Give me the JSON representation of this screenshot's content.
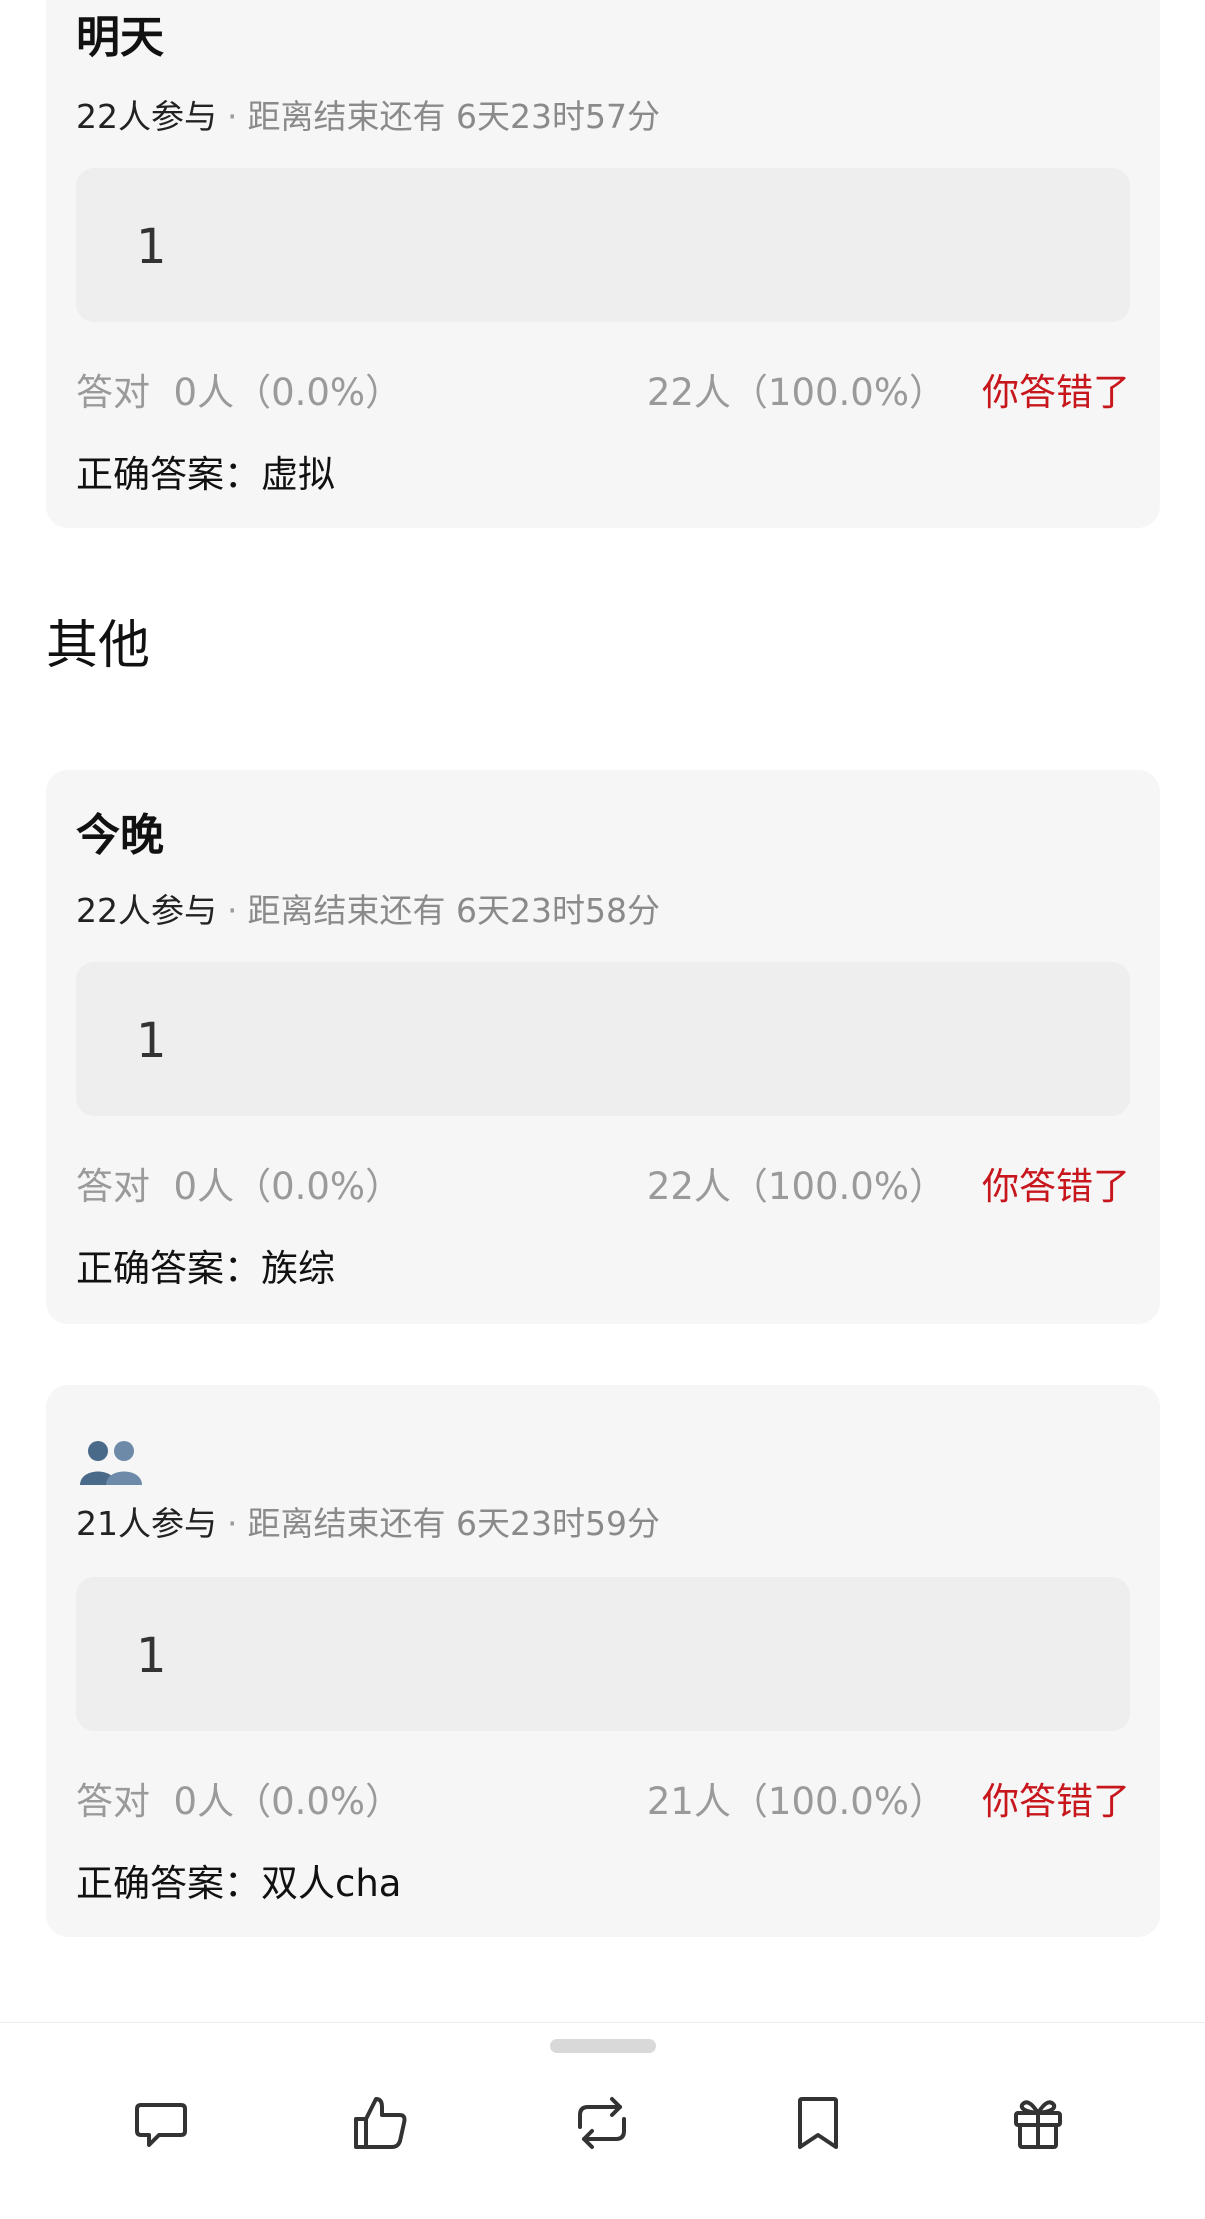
{
  "cards": [
    {
      "title": "明天",
      "participants": "22人参与",
      "separator": "·",
      "deadline": "距离结束还有 6天23时57分",
      "answer": "1",
      "correct_stat_label": "答对",
      "correct_stat": "0人（0.0%）",
      "wrong_stat": "22人（100.0%）",
      "result_label": "你答错了",
      "correct_answer_label": "正确答案：",
      "correct_answer": "虚拟"
    },
    {
      "title": "今晚",
      "participants": "22人参与",
      "separator": "·",
      "deadline": "距离结束还有 6天23时58分",
      "answer": "1",
      "correct_stat_label": "答对",
      "correct_stat": "0人（0.0%）",
      "wrong_stat": "22人（100.0%）",
      "result_label": "你答错了",
      "correct_answer_label": "正确答案：",
      "correct_answer": "族综"
    },
    {
      "title_icon": "two-people-silhouette-emoji",
      "participants": "21人参与",
      "separator": "·",
      "deadline": "距离结束还有 6天23时59分",
      "answer": "1",
      "correct_stat_label": "答对",
      "correct_stat": "0人（0.0%）",
      "wrong_stat": "21人（100.0%）",
      "result_label": "你答错了",
      "correct_answer_label": "正确答案：",
      "correct_answer": "双人cha"
    }
  ],
  "section_heading": "其他",
  "toolbar": {
    "items": [
      "comment-icon",
      "like-icon",
      "repost-icon",
      "bookmark-icon",
      "gift-icon"
    ]
  },
  "colors": {
    "card_bg": "#f6f6f6",
    "answer_bg": "#eeeeee",
    "wrong_red": "#c8161d",
    "muted_gray": "#9a9a9a"
  }
}
